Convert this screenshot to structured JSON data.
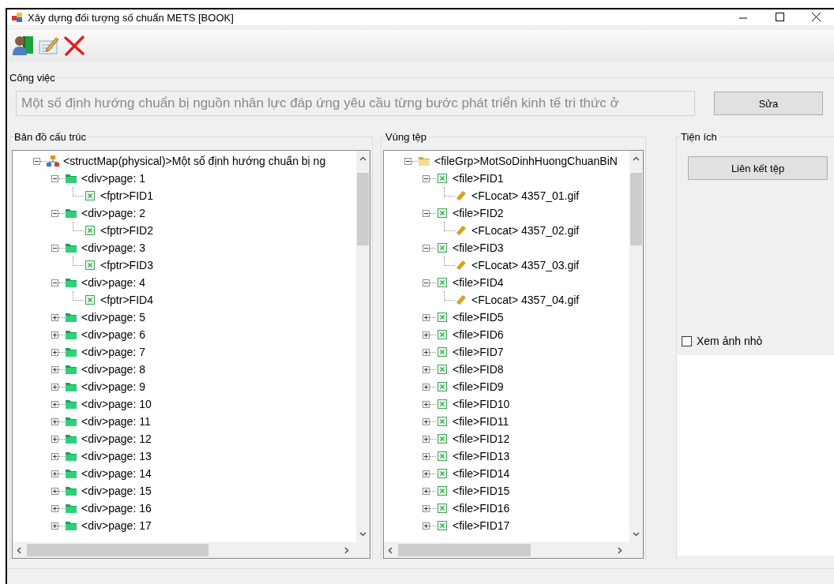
{
  "window": {
    "title": "Xây dựng đối tượng số chuẩn METS [BOOK]"
  },
  "toolbar": [
    {
      "kind": "user"
    },
    {
      "kind": "edit"
    },
    {
      "kind": "delete"
    }
  ],
  "task": {
    "label": "Công việc",
    "value": "Một số định hướng chuẩn bị nguồn nhân lực đáp ứng yêu cầu từng bước phát triển kinh tế tri thức ở",
    "disabled": true,
    "button": "Sửa"
  },
  "structure": {
    "label": "Bản đồ cấu trúc",
    "tree": [
      {
        "kind": "structmap",
        "label": "<structMap(physical)>Một số định hướng chuẩn bị ng",
        "expanded": true,
        "children": [
          {
            "kind": "div",
            "label": "<div>page:  1",
            "expanded": true,
            "children": [
              {
                "kind": "fptr",
                "label": "<fptr>FID1"
              }
            ]
          },
          {
            "kind": "div",
            "label": "<div>page:  2",
            "expanded": true,
            "children": [
              {
                "kind": "fptr",
                "label": "<fptr>FID2"
              }
            ]
          },
          {
            "kind": "div",
            "label": "<div>page:  3",
            "expanded": true,
            "children": [
              {
                "kind": "fptr",
                "label": "<fptr>FID3"
              }
            ]
          },
          {
            "kind": "div",
            "label": "<div>page:  4",
            "expanded": true,
            "children": [
              {
                "kind": "fptr",
                "label": "<fptr>FID4"
              }
            ]
          },
          {
            "kind": "div",
            "label": "<div>page:  5",
            "expanded": false
          },
          {
            "kind": "div",
            "label": "<div>page:  6",
            "expanded": false
          },
          {
            "kind": "div",
            "label": "<div>page:  7",
            "expanded": false
          },
          {
            "kind": "div",
            "label": "<div>page:  8",
            "expanded": false
          },
          {
            "kind": "div",
            "label": "<div>page:  9",
            "expanded": false
          },
          {
            "kind": "div",
            "label": "<div>page:  10",
            "expanded": false
          },
          {
            "kind": "div",
            "label": "<div>page:  11",
            "expanded": false
          },
          {
            "kind": "div",
            "label": "<div>page:  12",
            "expanded": false
          },
          {
            "kind": "div",
            "label": "<div>page:  13",
            "expanded": false
          },
          {
            "kind": "div",
            "label": "<div>page:  14",
            "expanded": false
          },
          {
            "kind": "div",
            "label": "<div>page:  15",
            "expanded": false
          },
          {
            "kind": "div",
            "label": "<div>page:  16",
            "expanded": false
          },
          {
            "kind": "div",
            "label": "<div>page:  17",
            "expanded": false
          }
        ]
      }
    ]
  },
  "files": {
    "label": "Vùng tệp",
    "tree": [
      {
        "kind": "filegrp",
        "label": "<fileGrp>MotSoDinhHuongChuanBiN",
        "expanded": true,
        "children": [
          {
            "kind": "file",
            "label": "<file>FID1",
            "expanded": true,
            "children": [
              {
                "kind": "flocat",
                "label": "<FLocat> 4357_01.gif"
              }
            ]
          },
          {
            "kind": "file",
            "label": "<file>FID2",
            "expanded": true,
            "children": [
              {
                "kind": "flocat",
                "label": "<FLocat> 4357_02.gif"
              }
            ]
          },
          {
            "kind": "file",
            "label": "<file>FID3",
            "expanded": true,
            "children": [
              {
                "kind": "flocat",
                "label": "<FLocat> 4357_03.gif"
              }
            ]
          },
          {
            "kind": "file",
            "label": "<file>FID4",
            "expanded": true,
            "children": [
              {
                "kind": "flocat",
                "label": "<FLocat> 4357_04.gif"
              }
            ]
          },
          {
            "kind": "file",
            "label": "<file>FID5",
            "expanded": false
          },
          {
            "kind": "file",
            "label": "<file>FID6",
            "expanded": false
          },
          {
            "kind": "file",
            "label": "<file>FID7",
            "expanded": false
          },
          {
            "kind": "file",
            "label": "<file>FID8",
            "expanded": false
          },
          {
            "kind": "file",
            "label": "<file>FID9",
            "expanded": false
          },
          {
            "kind": "file",
            "label": "<file>FID10",
            "expanded": false
          },
          {
            "kind": "file",
            "label": "<file>FID11",
            "expanded": false
          },
          {
            "kind": "file",
            "label": "<file>FID12",
            "expanded": false
          },
          {
            "kind": "file",
            "label": "<file>FID13",
            "expanded": false
          },
          {
            "kind": "file",
            "label": "<file>FID14",
            "expanded": false
          },
          {
            "kind": "file",
            "label": "<file>FID15",
            "expanded": false
          },
          {
            "kind": "file",
            "label": "<file>FID16",
            "expanded": false
          },
          {
            "kind": "file",
            "label": "<file>FID17",
            "expanded": false
          }
        ]
      }
    ]
  },
  "tools": {
    "label": "Tiện ích",
    "button": "Liên kết tệp",
    "thumbnail": {
      "label": "Xem ảnh nhỏ",
      "checked": false
    }
  }
}
